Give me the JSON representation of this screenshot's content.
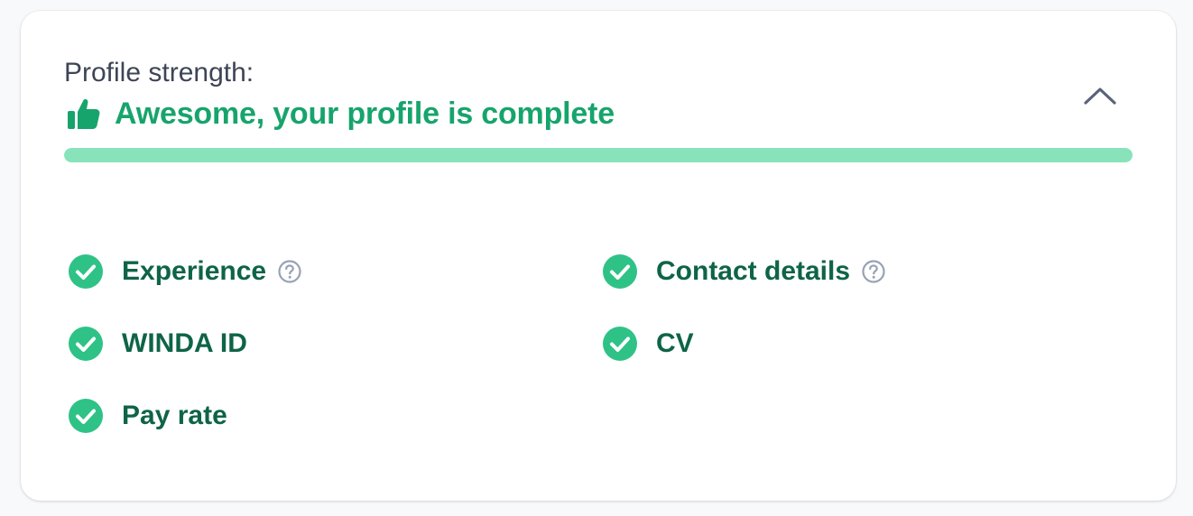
{
  "profile": {
    "label": "Profile strength:",
    "status_text": "Awesome, your profile is complete",
    "status_icon": "thumbs-up-icon",
    "progress_fraction": 1.0,
    "collapse_icon": "chevron-up-icon"
  },
  "colors": {
    "accent_green": "#17a46c",
    "check_green": "#2fc287",
    "label_dark_green": "#0e6447",
    "progress_fill": "#88e3bb",
    "help_gray": "#98a2b3"
  },
  "items": [
    {
      "label": "Experience",
      "complete": true,
      "has_help": true
    },
    {
      "label": "Contact details",
      "complete": true,
      "has_help": true
    },
    {
      "label": "WINDA ID",
      "complete": true,
      "has_help": false
    },
    {
      "label": "CV",
      "complete": true,
      "has_help": false
    },
    {
      "label": "Pay rate",
      "complete": true,
      "has_help": false
    }
  ]
}
